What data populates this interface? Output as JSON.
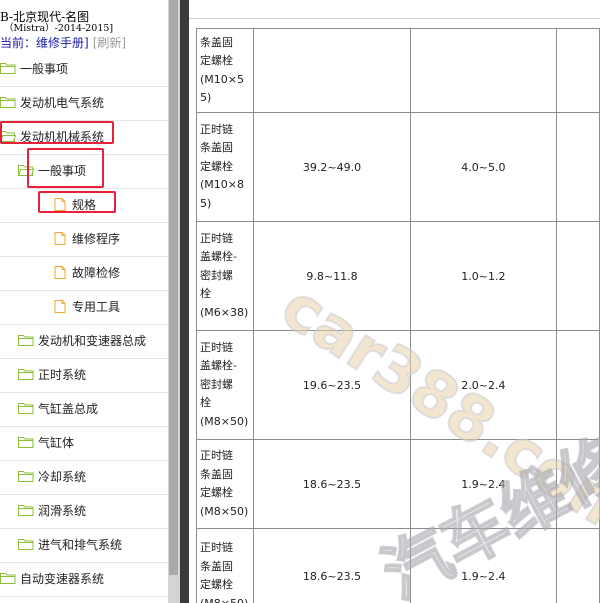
{
  "tree": {
    "header_title": "B-北京现代-名图",
    "header_subtitle": "（Mistra）-2014-2015]",
    "current_label": "当前：维修手册]",
    "refresh_label": "[刷新]",
    "items": [
      {
        "label": "一般事项",
        "icon": "folder-icon"
      },
      {
        "label": "发动机电气系统",
        "icon": "folder-icon"
      },
      {
        "label": "发动机机械系统",
        "icon": "folder-open-icon"
      },
      {
        "label": "一般事项",
        "icon": "folder-open-icon"
      },
      {
        "label": "规格",
        "icon": "document-icon"
      },
      {
        "label": "维修程序",
        "icon": "document-icon"
      },
      {
        "label": "故障检修",
        "icon": "document-icon"
      },
      {
        "label": "专用工具",
        "icon": "document-icon"
      },
      {
        "label": "发动机和变速器总成",
        "icon": "folder-icon"
      },
      {
        "label": "正时系统",
        "icon": "folder-icon"
      },
      {
        "label": "气缸盖总成",
        "icon": "folder-icon"
      },
      {
        "label": "气缸体",
        "icon": "folder-icon"
      },
      {
        "label": "冷却系统",
        "icon": "folder-icon"
      },
      {
        "label": "润滑系统",
        "icon": "folder-icon"
      },
      {
        "label": "进气和排气系统",
        "icon": "folder-icon"
      },
      {
        "label": "自动变速器系统",
        "icon": "folder-icon"
      }
    ]
  },
  "table": {
    "rows": [
      {
        "item": [
          "条盖固",
          "定螺栓",
          "(M10×5",
          "5)"
        ],
        "nm": "",
        "kgfm": ""
      },
      {
        "item": [
          "正时链",
          "条盖固",
          "定螺栓",
          "(M10×8",
          "5)"
        ],
        "nm": "39.2~49.0",
        "kgfm": "4.0~5.0"
      },
      {
        "item": [
          "正时链",
          "盖螺栓-",
          "密封螺",
          "栓",
          "(M6×38)"
        ],
        "nm": "9.8~11.8",
        "kgfm": "1.0~1.2"
      },
      {
        "item": [
          "正时链",
          "盖螺栓-",
          "密封螺",
          "栓",
          "(M8×50)"
        ],
        "nm": "19.6~23.5",
        "kgfm": "2.0~2.4"
      },
      {
        "item": [
          "正时链",
          "条盖固",
          "定螺栓",
          "(M8×50)"
        ],
        "nm": "18.6~23.5",
        "kgfm": "1.9~2.4"
      },
      {
        "item": [
          "正时链",
          "条盖固",
          "定螺栓",
          "(M8×50)"
        ],
        "nm": "18.6~23.5",
        "kgfm": "1.9~2.4"
      }
    ]
  },
  "watermark": {
    "site": "car388.com",
    "text": "汽车维修"
  },
  "colors": {
    "highlight": "#e8203a",
    "folder": "#8bbf3a",
    "document": "#f0a830",
    "link": "#1a1aa6"
  }
}
